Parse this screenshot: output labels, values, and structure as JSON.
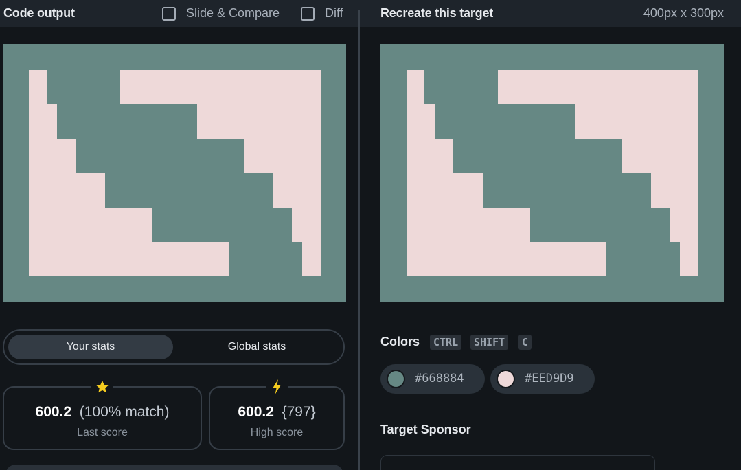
{
  "left_panel": {
    "title": "Code output",
    "slide_compare": {
      "label": "Slide & Compare",
      "checked": false
    },
    "diff": {
      "label": "Diff",
      "checked": false
    }
  },
  "right_panel": {
    "title": "Recreate this target",
    "dimensions": "400px x 300px"
  },
  "canvas_colors": {
    "background": "#668884",
    "foreground": "#EED9D9"
  },
  "stats": {
    "tabs": [
      {
        "label": "Your stats",
        "active": true
      },
      {
        "label": "Global stats",
        "active": false
      }
    ],
    "last_score": {
      "value": "600.2",
      "detail": "(100% match)",
      "label": "Last score",
      "icon": "star-icon"
    },
    "high_score": {
      "value": "600.2",
      "detail": "{797}",
      "label": "High score",
      "icon": "lightning-icon"
    }
  },
  "colors": {
    "title": "Colors",
    "shortcut": [
      "CTRL",
      "SHIFT",
      "C"
    ],
    "swatches": [
      {
        "hex": "#668884"
      },
      {
        "hex": "#EED9D9"
      }
    ]
  },
  "sponsor": {
    "title": "Target Sponsor"
  }
}
